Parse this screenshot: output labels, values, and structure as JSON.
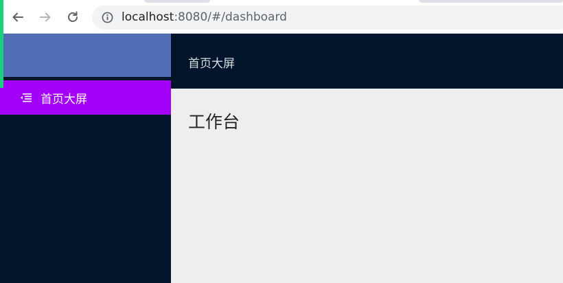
{
  "browser": {
    "url_host": "localhost",
    "url_rest": ":8080/#/dashboard"
  },
  "sidebar": {
    "menu_items": [
      {
        "label": "首页大屏",
        "icon": "menu-fold-icon",
        "active": true
      }
    ]
  },
  "header": {
    "title": "首页大屏"
  },
  "main": {
    "page_title": "工作台"
  },
  "colors": {
    "sidebar_bg": "#00152a",
    "logo_bg": "#4f6eb4",
    "active_menu_bg": "#a200f7",
    "content_bg": "#eeeeef",
    "accent_green": "#19d17b"
  }
}
